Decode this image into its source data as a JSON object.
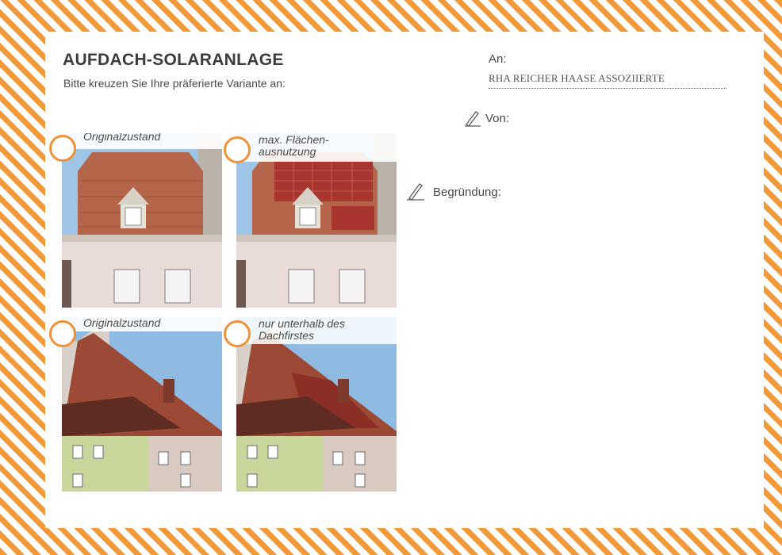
{
  "header": {
    "title": "AUFDACH-SOLARANLAGE",
    "subtitle": "Bitte kreuzen Sie Ihre präferierte Variante an:"
  },
  "options": [
    {
      "caption": "Originalzustand",
      "icon": "radio-circle"
    },
    {
      "caption_line1": "max. Flächen-",
      "caption_line2": "ausnutzung",
      "icon": "radio-circle"
    },
    {
      "caption": "Originalzustand",
      "icon": "radio-circle"
    },
    {
      "caption_line1": "nur unterhalb des",
      "caption_line2": "Dachfirstes",
      "icon": "radio-circle"
    }
  ],
  "form": {
    "to_label": "An:",
    "to_value": "RHA REICHER HAASE ASSOZIIERTE",
    "from_label": "Von:",
    "reason_label": "Begründung:"
  },
  "colors": {
    "accent_orange": "#f29a3a",
    "stripe_white": "#ffffff",
    "text_grey": "#3b3b3b"
  },
  "icons": [
    "pen-icon",
    "radio-circle"
  ]
}
